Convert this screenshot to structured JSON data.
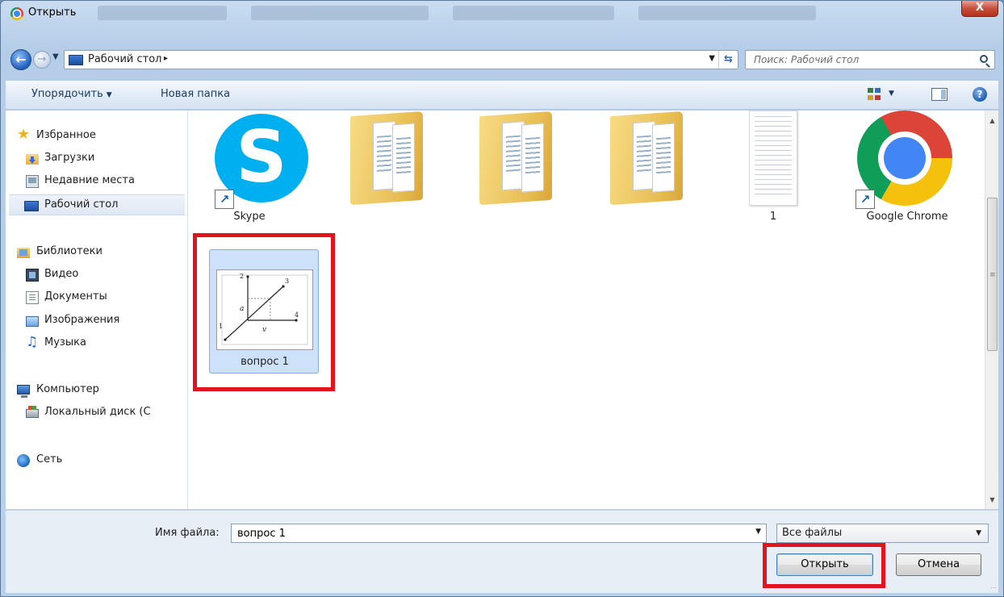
{
  "window": {
    "title": "Открыть",
    "close_symbol": "X",
    "app_icon": "chrome-icon"
  },
  "address_bar": {
    "location_icon": "desktop-icon",
    "path": "Рабочий стол",
    "breadcrumb_arrow": "▸",
    "search_placeholder": "Поиск: Рабочий стол"
  },
  "toolbar": {
    "organize_label": "Упорядочить",
    "new_folder_label": "Новая папка",
    "view_icon": "change-view-icon",
    "preview_icon": "preview-pane-icon",
    "help_icon": "help-icon"
  },
  "nav_pane": {
    "favorites": "Избранное",
    "downloads": "Загрузки",
    "recent_places": "Недавние места",
    "desktop": "Рабочий стол",
    "libraries": "Библиотеки",
    "video": "Видео",
    "documents": "Документы",
    "pictures": "Изображения",
    "music": "Музыка",
    "computer": "Компьютер",
    "local_disk": "Локальный диск (С",
    "network": "Сеть"
  },
  "files": [
    {
      "name": "Skype",
      "type": "shortcut",
      "icon": "skype-icon"
    },
    {
      "name": "",
      "type": "folder",
      "icon": "folder-icon"
    },
    {
      "name": "",
      "type": "folder",
      "icon": "folder-icon"
    },
    {
      "name": "",
      "type": "folder",
      "icon": "folder-icon"
    },
    {
      "name": "1",
      "type": "document",
      "icon": "document-icon"
    },
    {
      "name": "Google Chrome",
      "type": "shortcut",
      "icon": "chrome-icon"
    },
    {
      "name": "вопрос 1",
      "type": "image",
      "icon": "image-thumbnail",
      "selected": true
    }
  ],
  "thumbnail_labels": [
    "1",
    "2",
    "3",
    "4",
    "a",
    "v"
  ],
  "bottom": {
    "filename_label": "Имя файла:",
    "filename_value": "вопрос 1",
    "file_type": "Все файлы",
    "open_button": "Открыть",
    "cancel_button": "Отмена"
  },
  "highlight_color": "#e3141f",
  "selection_color": "#cde2fa"
}
